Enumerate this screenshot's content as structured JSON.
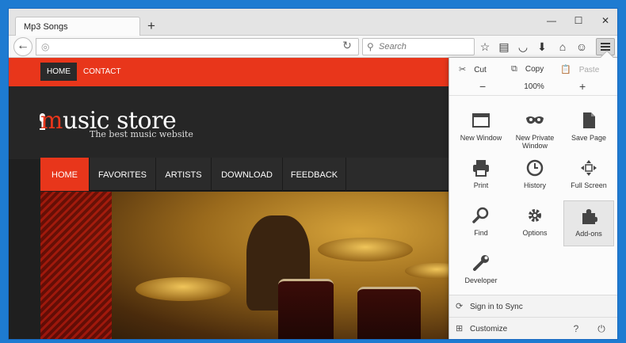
{
  "browser": {
    "tab_title": "Mp3 Songs",
    "new_tab": "+",
    "window_controls": {
      "minimize": "—",
      "maximize": "☐",
      "close": "✕"
    },
    "search_placeholder": "Search",
    "toolbar_icons": [
      "bookmark-star-icon",
      "reading-list-icon",
      "pocket-icon",
      "download-icon",
      "home-icon",
      "hello-icon",
      "menu-icon"
    ]
  },
  "website": {
    "top_nav": [
      "HOME",
      "CONTACT"
    ],
    "logo_initial": "m",
    "logo_rest": "usic store",
    "tagline": "The best music website",
    "main_nav": [
      "HOME",
      "FAVORITES",
      "ARTISTS",
      "DOWNLOAD",
      "FEEDBACK"
    ],
    "accent_color": "#e8361b"
  },
  "menu_panel": {
    "cut": "Cut",
    "copy": "Copy",
    "paste": "Paste",
    "zoom_out": "−",
    "zoom_level": "100%",
    "zoom_in": "+",
    "items": [
      {
        "label": "New Window",
        "icon": "new-window-icon"
      },
      {
        "label": "New Private Window",
        "icon": "private-window-icon"
      },
      {
        "label": "Save Page",
        "icon": "save-page-icon"
      },
      {
        "label": "Print",
        "icon": "print-icon"
      },
      {
        "label": "History",
        "icon": "history-icon"
      },
      {
        "label": "Full Screen",
        "icon": "full-screen-icon"
      },
      {
        "label": "Find",
        "icon": "find-icon"
      },
      {
        "label": "Options",
        "icon": "options-icon"
      },
      {
        "label": "Add-ons",
        "icon": "addons-icon"
      },
      {
        "label": "Developer",
        "icon": "developer-icon"
      }
    ],
    "sync": "Sign in to Sync",
    "customize": "Customize"
  }
}
